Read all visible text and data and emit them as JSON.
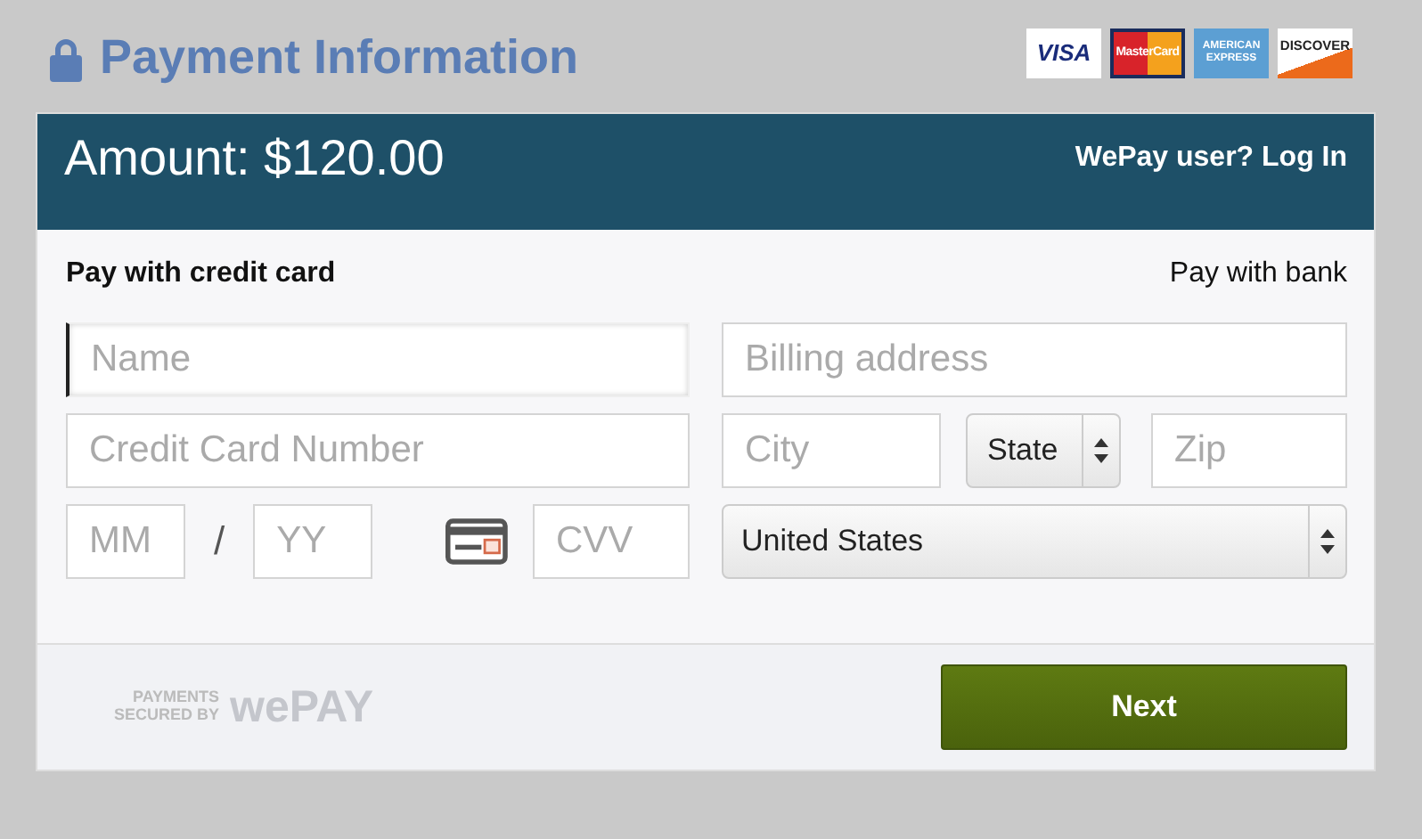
{
  "header": {
    "title": "Payment Information",
    "cards": [
      {
        "kind": "visa",
        "label": "VISA"
      },
      {
        "kind": "mastercard",
        "label": "MasterCard"
      },
      {
        "kind": "amex",
        "label": "AMERICAN EXPRESS"
      },
      {
        "kind": "discover",
        "label": "DISCOVER"
      }
    ]
  },
  "banner": {
    "amount": "Amount: $120.00",
    "login": "WePay user? Log In"
  },
  "tabs": [
    {
      "label": "Pay with credit card",
      "selected": true
    },
    {
      "label": "Pay with bank",
      "selected": false
    }
  ],
  "card_fields": {
    "name": {
      "placeholder": "Name",
      "focused": true
    },
    "number": {
      "placeholder": "Credit Card Number",
      "focused": false
    },
    "month": {
      "placeholder": "MM",
      "focused": false
    },
    "separator": "/",
    "year": {
      "placeholder": "YY",
      "focused": false
    },
    "cvv": {
      "placeholder": "CVV",
      "focused": false
    }
  },
  "address_fields": {
    "address": {
      "placeholder": "Billing address",
      "focused": false
    },
    "city": {
      "placeholder": "City",
      "focused": false
    },
    "state": {
      "value": "State"
    },
    "zip": {
      "placeholder": "Zip",
      "focused": false
    },
    "country": {
      "value": "United States"
    }
  },
  "footer": {
    "secured_by": "PAYMENTS SECURED BY",
    "brand": "wePAY",
    "button": "Next"
  }
}
